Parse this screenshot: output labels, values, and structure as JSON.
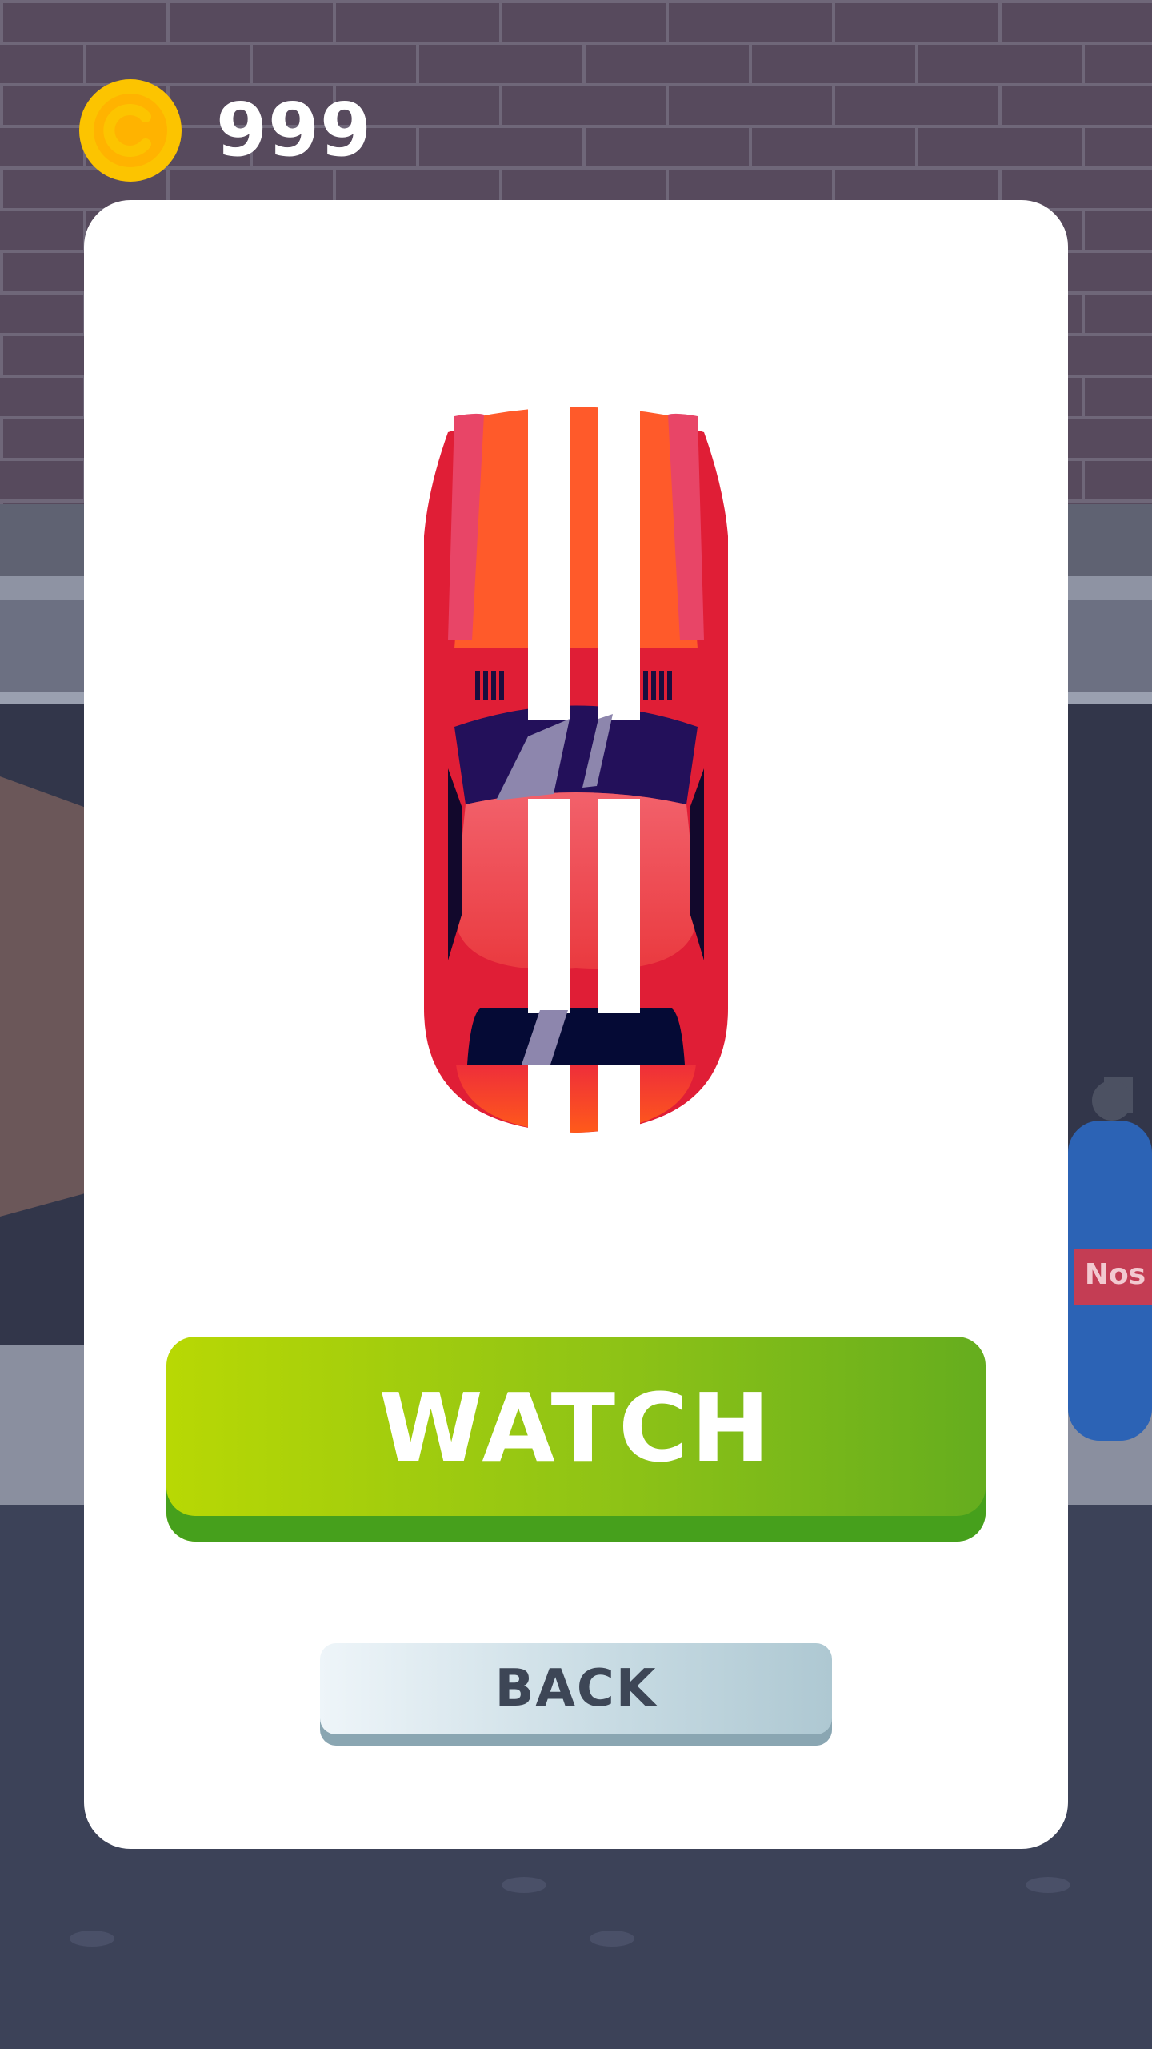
{
  "hud": {
    "coin_icon": "coin-icon",
    "coin_count": "999"
  },
  "reward_card": {
    "car_icon": "red-sports-car-top-view",
    "watch_label": "WATCH",
    "back_label": "BACK"
  },
  "background": {
    "tank_label": "Nos"
  },
  "colors": {
    "watch_green": "#8ec316",
    "back_blue_grey": "#c9dce4",
    "coin_gold": "#fcc400",
    "car_red": "#e8263a",
    "brick_purple": "#5a4a5d"
  }
}
